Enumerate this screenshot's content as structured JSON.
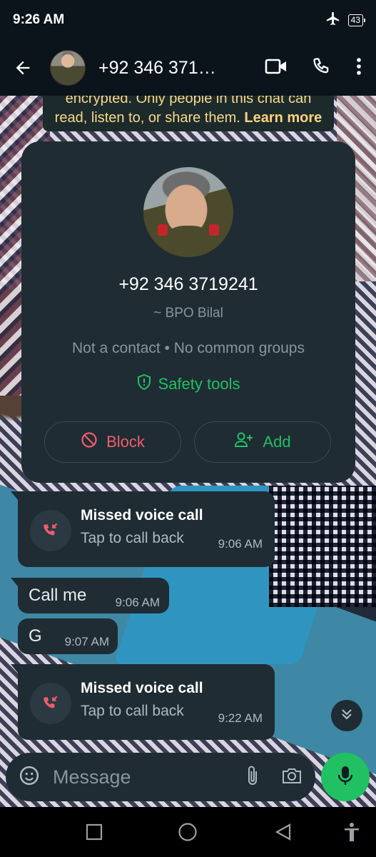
{
  "status_bar": {
    "time": "9:26 AM",
    "battery": "43"
  },
  "header": {
    "title": "+92 346 371…"
  },
  "encryption_notice": {
    "line1": "encrypted. Only people in this chat can",
    "line2": "read, listen to, or share them.",
    "learn_more": "Learn more"
  },
  "contact_card": {
    "number": "+92 346 3719241",
    "alias": "~ BPO Bilal",
    "info": "Not a contact • No common groups",
    "safety_tools": "Safety tools",
    "block_label": "Block",
    "add_label": "Add"
  },
  "messages": [
    {
      "type": "call",
      "title": "Missed voice call",
      "subtitle": "Tap to call back",
      "time": "9:06 AM"
    },
    {
      "type": "text",
      "text": "Call me",
      "time": "9:06 AM"
    },
    {
      "type": "text",
      "text": "G",
      "time": "9:07 AM"
    },
    {
      "type": "call",
      "title": "Missed voice call",
      "subtitle": "Tap to call back",
      "time": "9:22 AM"
    }
  ],
  "input": {
    "placeholder": "Message"
  },
  "colors": {
    "accent": "#21c063",
    "danger": "#f15c6d",
    "bubble": "#1f2c33",
    "header": "#0b141a"
  }
}
